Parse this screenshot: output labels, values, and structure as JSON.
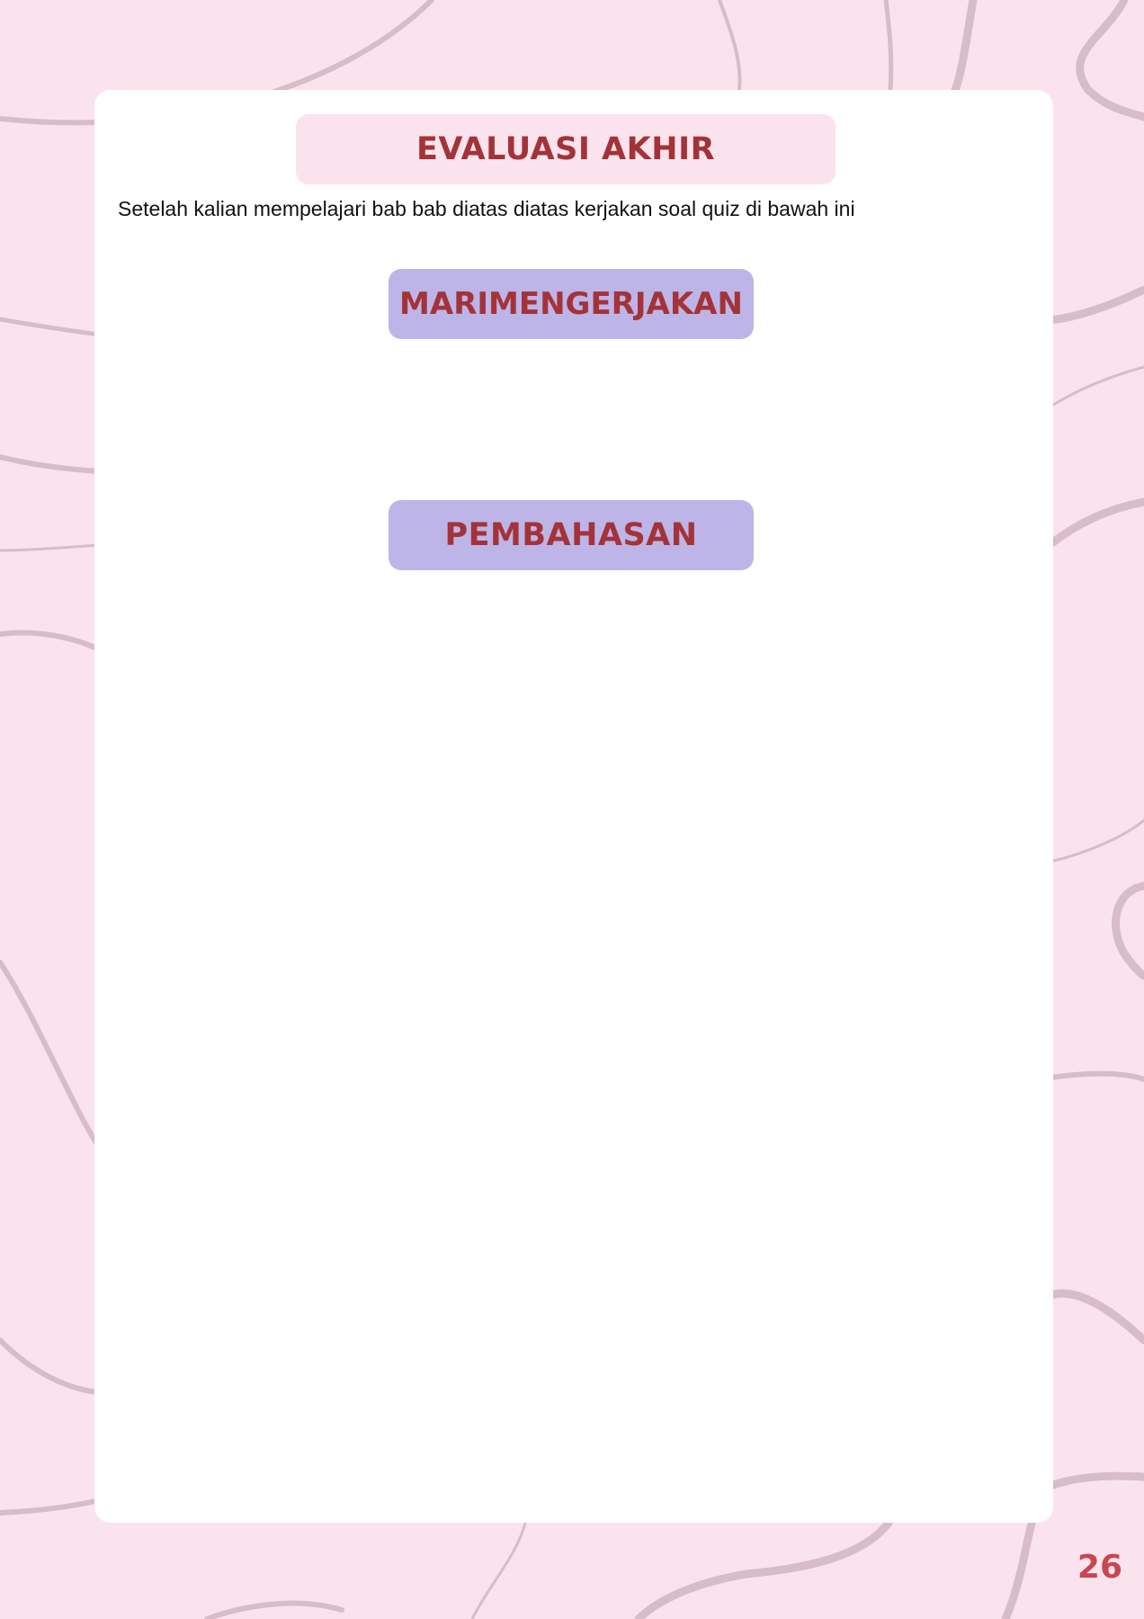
{
  "page": {
    "title": "EVALUASI AKHIR",
    "instruction": "Setelah kalian mempelajari bab bab diatas diatas kerjakan soal quiz di bawah ini",
    "buttons": {
      "start_quiz": "MARIMENGERJAKAN",
      "discussion": "PEMBAHASAN"
    },
    "page_number": "26"
  },
  "colors": {
    "background": "#fbe3ee",
    "card": "#ffffff",
    "title_box": "#fbe3ee",
    "button": "#bdb5e8",
    "heading_text": "#a33338",
    "page_number": "#c9474f",
    "decor_lines": "#d8bcc8"
  }
}
